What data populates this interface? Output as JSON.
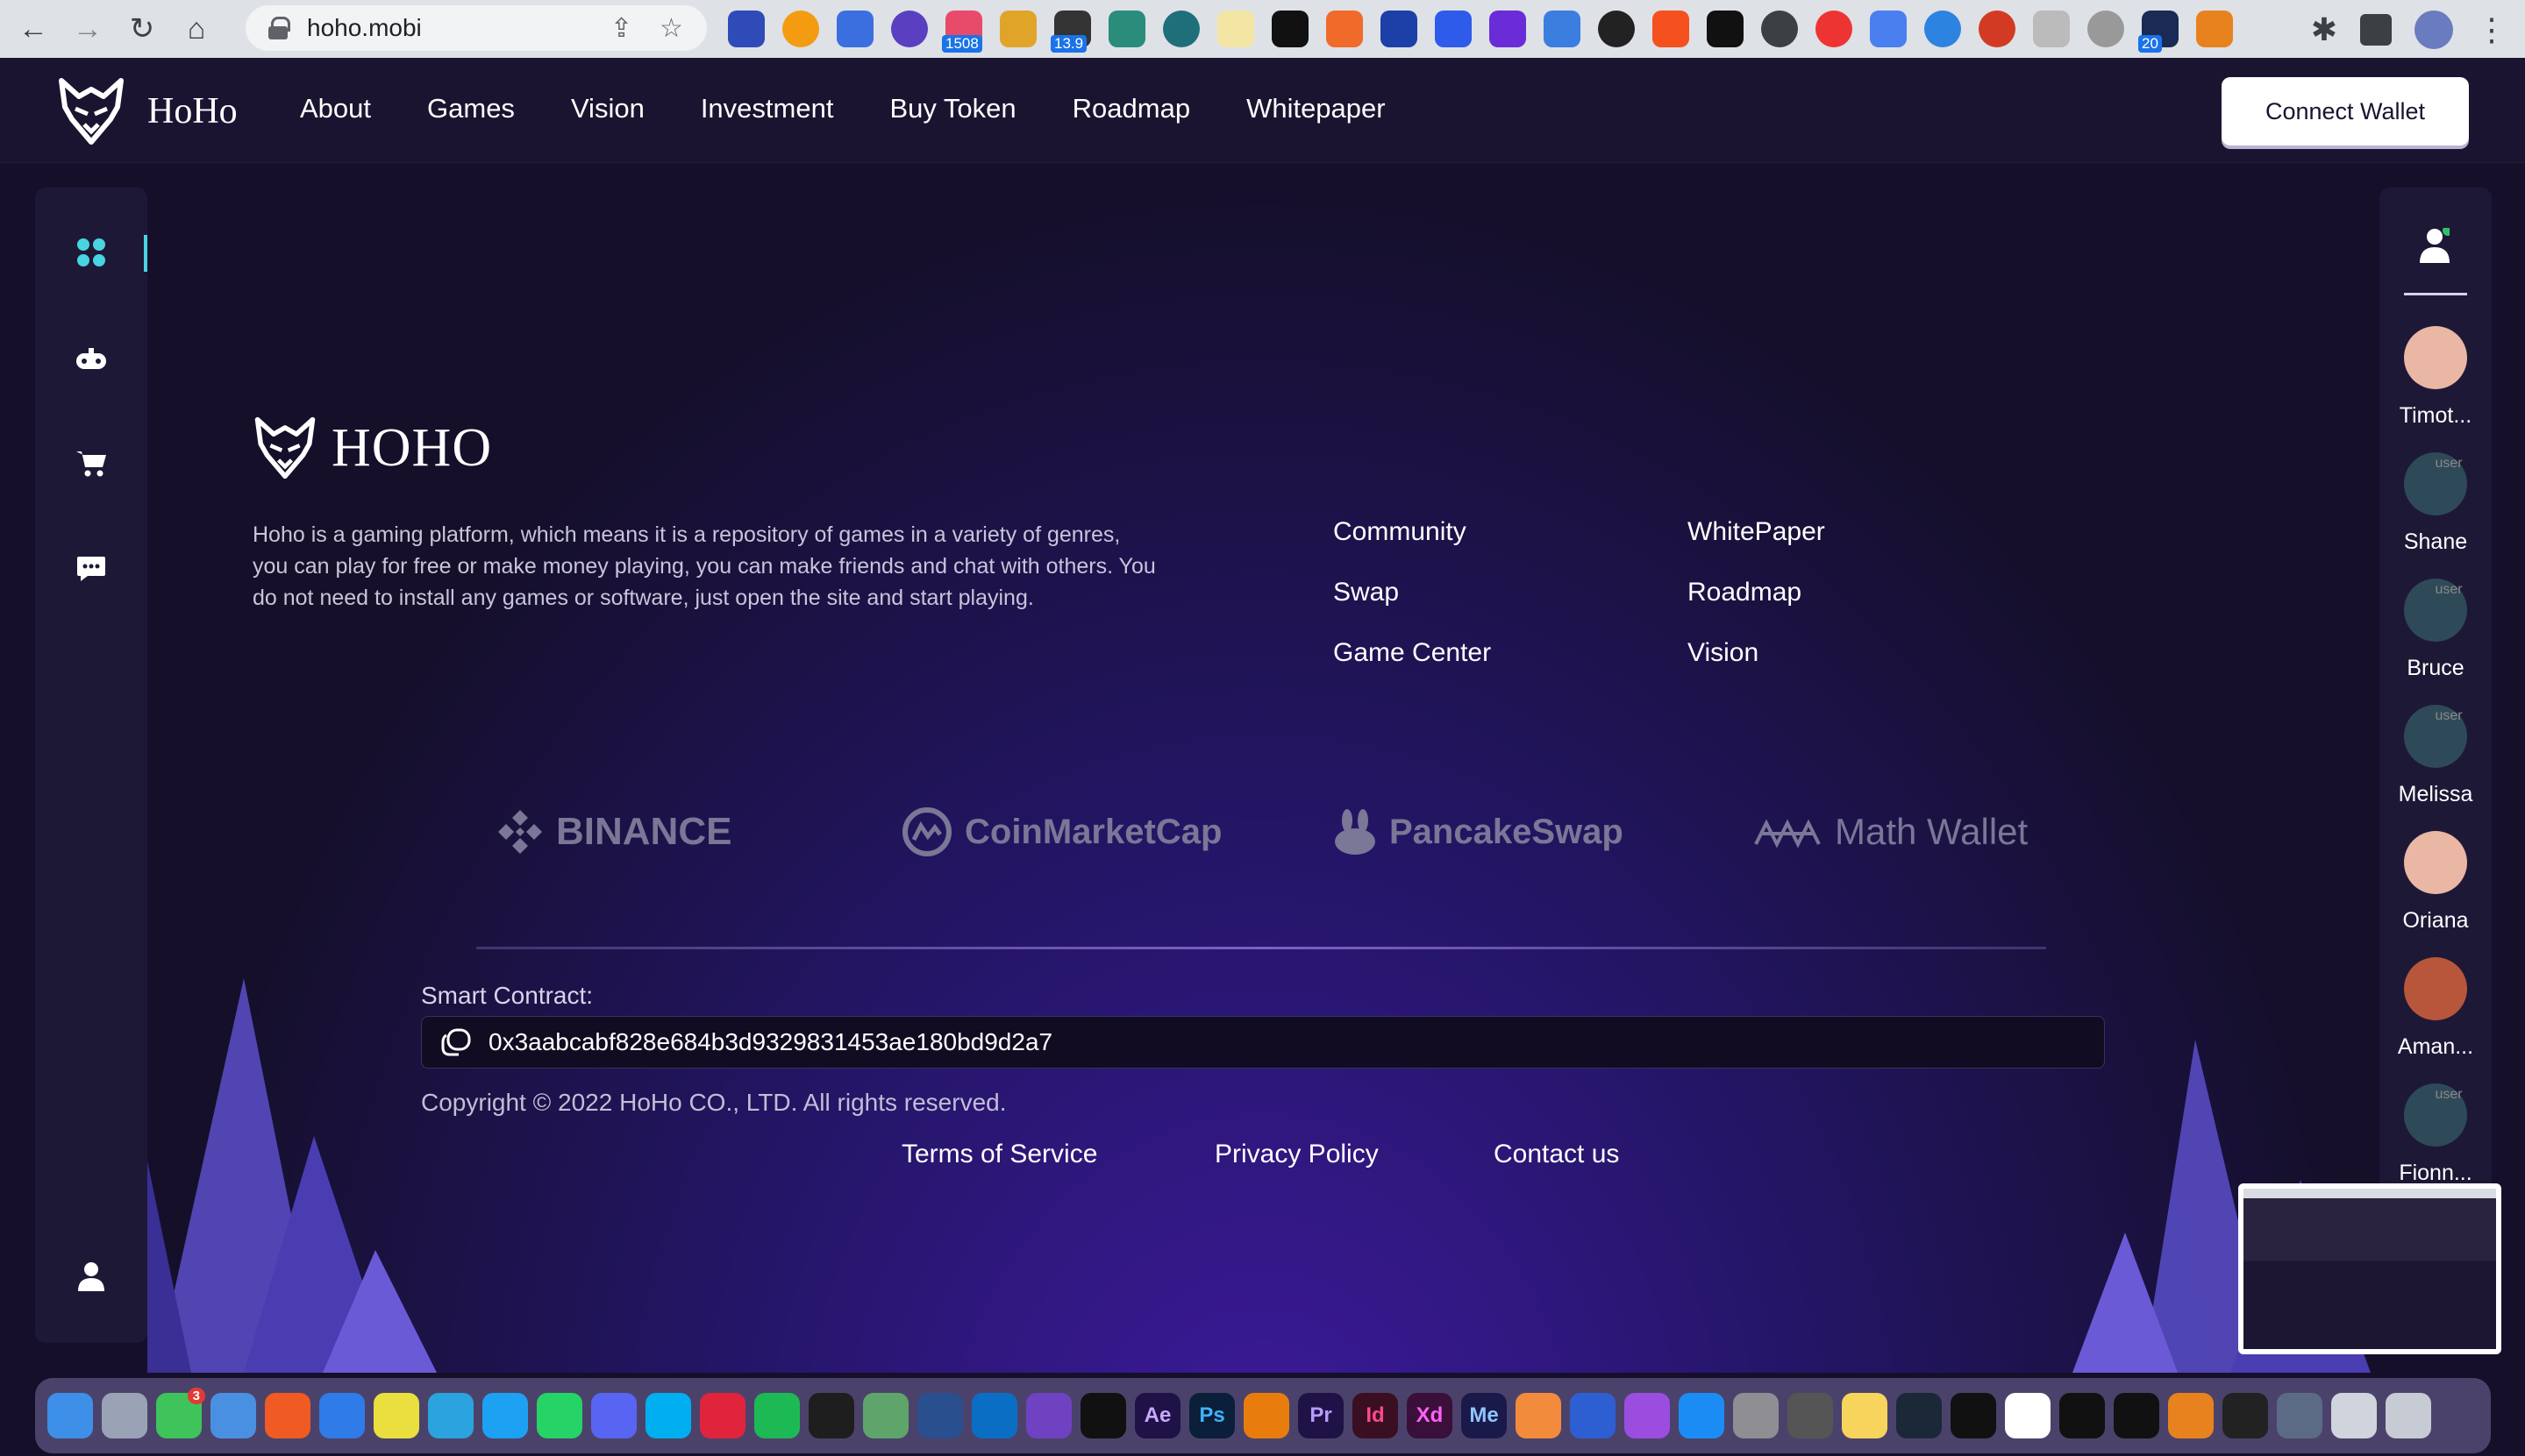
{
  "browser": {
    "url": "hoho.mobi",
    "badges": [
      "1508",
      "13.9",
      "20"
    ]
  },
  "header": {
    "brand": "HoHo",
    "nav": [
      "About",
      "Games",
      "Vision",
      "Investment",
      "Buy Token",
      "Roadmap",
      "Whitepaper"
    ],
    "connect_label": "Connect Wallet"
  },
  "left_rail": {
    "items": [
      "grid-icon",
      "gamepad-icon",
      "cart-icon",
      "chat-icon"
    ],
    "bottom": "user-icon"
  },
  "friends": {
    "header_icon": "user-icon",
    "online_color": "#2fbf71",
    "list": [
      {
        "name": "Timot...",
        "avatar": "avatar"
      },
      {
        "name": "Shane",
        "avatar": "broken-image",
        "alt": "user"
      },
      {
        "name": "Bruce",
        "avatar": "broken-image",
        "alt": "user"
      },
      {
        "name": "Melissa",
        "avatar": "broken-image",
        "alt": "user"
      },
      {
        "name": "Oriana",
        "avatar": "avatar"
      },
      {
        "name": "Aman...",
        "avatar": "avatar"
      },
      {
        "name": "Fionn...",
        "avatar": "broken-image",
        "alt": "user"
      }
    ]
  },
  "footer": {
    "logo_text": "HOHO",
    "about": "Hoho is a gaming platform, which means it is a repository of games in a variety of genres, you can play for free or make money playing, you can make friends and chat with others. You do not need to install any games or software, just open the site and start playing.",
    "links_col1": [
      "Community",
      "Swap",
      "Game Center"
    ],
    "links_col2": [
      "WhitePaper",
      "Roadmap",
      "Vision"
    ],
    "partners": [
      "BINANCE",
      "CoinMarketCap",
      "PancakeSwap",
      "Math Wallet"
    ],
    "smart_contract_label": "Smart Contract:",
    "smart_contract_address": "0x3aabcabf828e684b3d9329831453ae180bd9d2a7",
    "copyright": "Copyright © 2022 HoHo CO., LTD. All rights reserved.",
    "legal": [
      "Terms of Service",
      "Privacy Policy",
      "Contact us"
    ]
  },
  "colors": {
    "accent": "#4ad3e0",
    "background": "#150f2a",
    "panel": "#1e1837",
    "glow": "#3d1a9c"
  },
  "dock": {
    "apps": [
      "Finder",
      "Launchpad",
      "Messages",
      "Mail",
      "Brave",
      "Safari",
      "Chrome",
      "Telegram",
      "Twitter",
      "WhatsApp",
      "Discord",
      "Skype",
      "Opera",
      "Spotify",
      "Figma",
      "Atom",
      "Qt",
      "VS Code",
      "GitHub",
      "Cinema 4D",
      "Ae",
      "Ps",
      "Blender",
      "Pr",
      "Id",
      "Xd",
      "Me",
      "Postman",
      "Arrow",
      "Podcasts",
      "App Store",
      "Settings",
      "Calculator",
      "Notes",
      "Steam",
      "Notion Dark",
      "Notion",
      "Frame",
      "TV",
      "MetaMask",
      "W",
      "Preview",
      "Printer",
      "Trash"
    ],
    "labels": [
      "Ae",
      "Ps",
      "Pr",
      "Id",
      "Xd",
      "Me"
    ],
    "notification": "3"
  }
}
